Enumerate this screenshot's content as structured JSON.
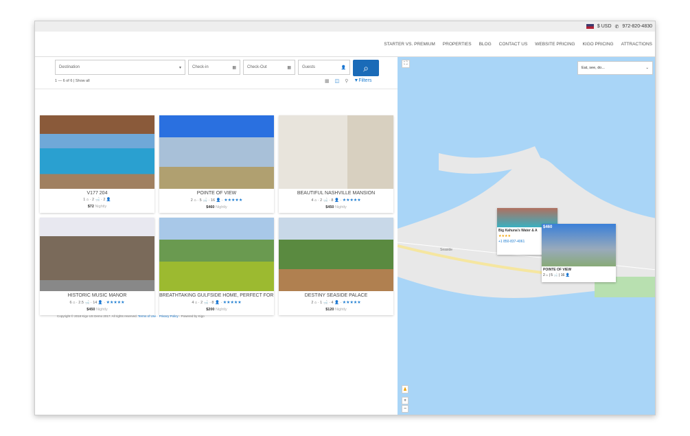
{
  "topbar": {
    "currency": "$ USD",
    "phone": "972-820-4830"
  },
  "nav": [
    "STARTER VS. PREMIUM",
    "PROPERTIES",
    "BLOG",
    "CONTACT US",
    "WEBSITE PRICING",
    "KIGO PRICING",
    "ATTRACTIONS"
  ],
  "search": {
    "destination": "Destination",
    "checkin": "Check-in",
    "checkout": "Check-Out",
    "guests": "Guests"
  },
  "results": {
    "count": "1 — 6 of 6 | Show all",
    "filters": "Filters"
  },
  "cards": [
    {
      "title": "V177 204",
      "meta": "1 ⌂ · 2 🛁 · 2 👤",
      "stars": "",
      "price": "$72",
      "unit": "Nightly"
    },
    {
      "title": "POINTE OF VIEW",
      "meta": "2 ⌂ · 5 🛁 · 16 👤 ·",
      "stars": "★★★★★",
      "price": "$460",
      "unit": "Nightly"
    },
    {
      "title": "BEAUTIFUL NASHVILLE MANSION",
      "meta": "4 ⌂ · 2 🛁 · 8 👤 ·",
      "stars": "★★★★★",
      "price": "$450",
      "unit": "Nightly"
    },
    {
      "title": "HISTORIC MUSIC MANOR",
      "meta": "6 ⌂ · 2.5 🛁 · 14 👤 ·",
      "stars": "★★★★★",
      "price": "$450",
      "unit": "Nightly"
    },
    {
      "title": "BREATHTAKING GULFSIDE HOME, PERFECT FOR...",
      "meta": "4 ⌂ · 2 🛁 · 8 👤 ·",
      "stars": "★★★★★",
      "price": "$200",
      "unit": "Nightly"
    },
    {
      "title": "DESTINY SEASIDE PALACE",
      "meta": "2 ⌂ · 1 🛁 · 4 👤 ·",
      "stars": "★★★★★",
      "price": "$120",
      "unit": "Nightly"
    }
  ],
  "footer": {
    "copy": "Copyright © 2018 Kigo US Demo 2017. All rights reserved.",
    "terms": "Terms of Use",
    "privacy": "Privacy Policy",
    "powered": "· Powered by Kigo"
  },
  "map": {
    "select": "Eat, see, do...",
    "popup1": {
      "title": "Big Kahuna's Water & A",
      "stars": "★★★★",
      "phone": "+1 850-837-4061"
    },
    "popup2": {
      "price": "$460",
      "title": "POINTE OF VIEW",
      "meta": "2 ⌂ | 5 🛁 | 16 👤"
    },
    "place": "Seaside",
    "zoom_in": "+",
    "zoom_out": "−"
  }
}
